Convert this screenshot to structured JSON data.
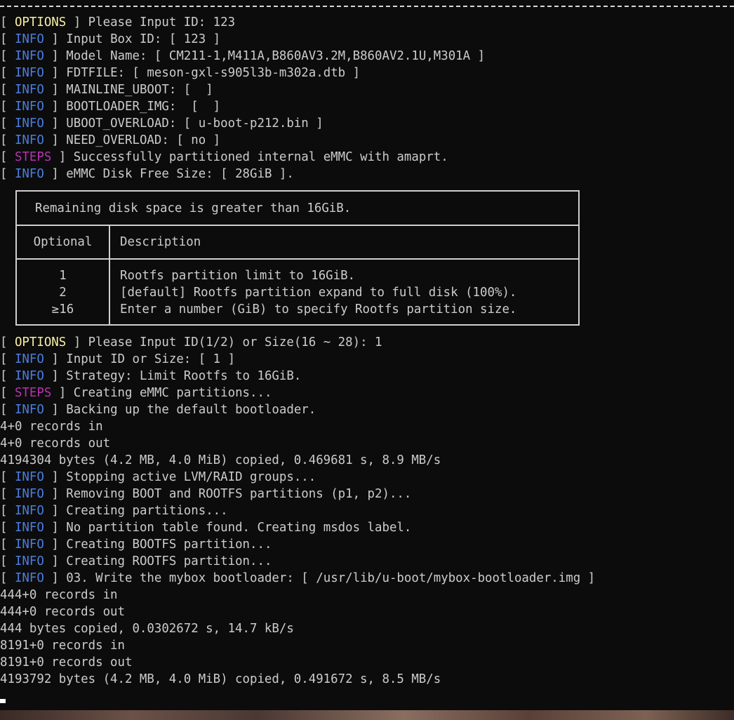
{
  "colors": {
    "background": "#0c0c0c",
    "text": "#cccccc",
    "options_tag": "#f9f1a5",
    "info_tag": "#4a7fe0",
    "steps_tag": "#b533b0"
  },
  "lines_top": [
    {
      "tag": "OPTIONS",
      "text": " Please Input ID: 123"
    },
    {
      "tag": "INFO",
      "text": " Input Box ID: [ 123 ]"
    },
    {
      "tag": "INFO",
      "text": " Model Name: [ CM211-1,M411A,B860AV3.2M,B860AV2.1U,M301A ]"
    },
    {
      "tag": "INFO",
      "text": " FDTFILE: [ meson-gxl-s905l3b-m302a.dtb ]"
    },
    {
      "tag": "INFO",
      "text": " MAINLINE_UBOOT: [  ]"
    },
    {
      "tag": "INFO",
      "text": " BOOTLOADER_IMG:  [  ]"
    },
    {
      "tag": "INFO",
      "text": " UBOOT_OVERLOAD: [ u-boot-p212.bin ]"
    },
    {
      "tag": "INFO",
      "text": " NEED_OVERLOAD: [ no ]"
    },
    {
      "tag": "STEPS",
      "text": " Successfully partitioned internal eMMC with amaprt."
    },
    {
      "tag": "INFO",
      "text": " eMMC Disk Free Size: [ 28GiB ]."
    }
  ],
  "table": {
    "title": "Remaining disk space is greater than 16GiB.",
    "header_optional": "Optional",
    "header_description": "Description",
    "rows": [
      {
        "option": "1",
        "description": "Rootfs partition limit to 16GiB."
      },
      {
        "option": "2",
        "description": "[default] Rootfs partition expand to full disk (100%)."
      },
      {
        "option": "≥16",
        "description": "Enter a number (GiB) to specify Rootfs partition size."
      }
    ]
  },
  "lines_bottom": [
    {
      "tag": "OPTIONS",
      "text": " Please Input ID(1/2) or Size(16 ~ 28): 1"
    },
    {
      "tag": "INFO",
      "text": " Input ID or Size: [ 1 ]"
    },
    {
      "tag": "INFO",
      "text": " Strategy: Limit Rootfs to 16GiB."
    },
    {
      "tag": "STEPS",
      "text": " Creating eMMC partitions..."
    },
    {
      "tag": "INFO",
      "text": " Backing up the default bootloader."
    },
    {
      "tag": "",
      "text": "4+0 records in"
    },
    {
      "tag": "",
      "text": "4+0 records out"
    },
    {
      "tag": "",
      "text": "4194304 bytes (4.2 MB, 4.0 MiB) copied, 0.469681 s, 8.9 MB/s"
    },
    {
      "tag": "INFO",
      "text": " Stopping active LVM/RAID groups..."
    },
    {
      "tag": "INFO",
      "text": " Removing BOOT and ROOTFS partitions (p1, p2)..."
    },
    {
      "tag": "INFO",
      "text": " Creating partitions..."
    },
    {
      "tag": "INFO",
      "text": " No partition table found. Creating msdos label."
    },
    {
      "tag": "INFO",
      "text": " Creating BOOTFS partition..."
    },
    {
      "tag": "INFO",
      "text": " Creating ROOTFS partition..."
    },
    {
      "tag": "INFO",
      "text": " 03. Write the mybox bootloader: [ /usr/lib/u-boot/mybox-bootloader.img ]"
    },
    {
      "tag": "",
      "text": "444+0 records in"
    },
    {
      "tag": "",
      "text": "444+0 records out"
    },
    {
      "tag": "",
      "text": "444 bytes copied, 0.0302672 s, 14.7 kB/s"
    },
    {
      "tag": "",
      "text": "8191+0 records in"
    },
    {
      "tag": "",
      "text": "8191+0 records out"
    },
    {
      "tag": "",
      "text": "4193792 bytes (4.2 MB, 4.0 MiB) copied, 0.491672 s, 8.5 MB/s"
    }
  ]
}
